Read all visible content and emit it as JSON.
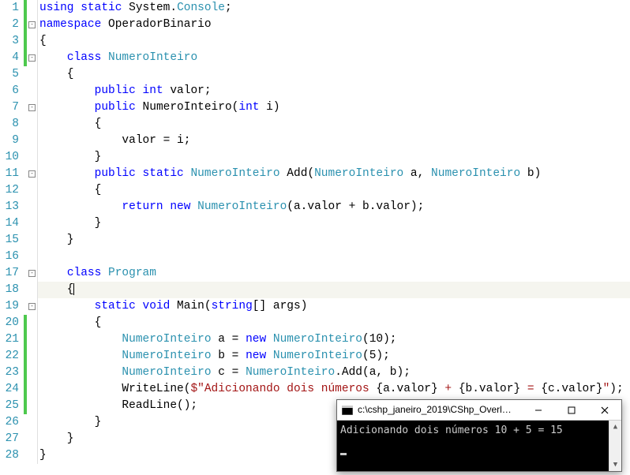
{
  "lines": [
    {
      "n": 1,
      "bar": "green",
      "fold": false,
      "html": "<span class='kw'>using</span> <span class='kw'>static</span> System.<span class='type'>Console</span>;"
    },
    {
      "n": 2,
      "bar": "green",
      "fold": true,
      "html": "<span class='kw'>namespace</span> OperadorBinario"
    },
    {
      "n": 3,
      "bar": "green",
      "fold": false,
      "html": "{"
    },
    {
      "n": 4,
      "bar": "green",
      "fold": true,
      "html": "    <span class='kw'>class</span> <span class='type'>NumeroInteiro</span>"
    },
    {
      "n": 5,
      "bar": "",
      "fold": false,
      "html": "    {"
    },
    {
      "n": 6,
      "bar": "",
      "fold": false,
      "html": "        <span class='kw'>public</span> <span class='kw'>int</span> valor;"
    },
    {
      "n": 7,
      "bar": "",
      "fold": true,
      "html": "        <span class='kw'>public</span> NumeroInteiro(<span class='kw'>int</span> i)"
    },
    {
      "n": 8,
      "bar": "",
      "fold": false,
      "html": "        {"
    },
    {
      "n": 9,
      "bar": "",
      "fold": false,
      "html": "            valor = i;"
    },
    {
      "n": 10,
      "bar": "",
      "fold": false,
      "html": "        }"
    },
    {
      "n": 11,
      "bar": "",
      "fold": true,
      "html": "        <span class='kw'>public</span> <span class='kw'>static</span> <span class='type'>NumeroInteiro</span> Add(<span class='type'>NumeroInteiro</span> a, <span class='type'>NumeroInteiro</span> b)"
    },
    {
      "n": 12,
      "bar": "",
      "fold": false,
      "html": "        {"
    },
    {
      "n": 13,
      "bar": "",
      "fold": false,
      "html": "            <span class='kw'>return</span> <span class='kw'>new</span> <span class='type'>NumeroInteiro</span>(a.valor + b.valor);"
    },
    {
      "n": 14,
      "bar": "",
      "fold": false,
      "html": "        }"
    },
    {
      "n": 15,
      "bar": "",
      "fold": false,
      "html": "    }"
    },
    {
      "n": 16,
      "bar": "",
      "fold": false,
      "html": ""
    },
    {
      "n": 17,
      "bar": "",
      "fold": true,
      "html": "    <span class='kw'>class</span> <span class='type'>Program</span>"
    },
    {
      "n": 18,
      "bar": "",
      "fold": false,
      "hl": true,
      "html": "    {<span class='caret'></span>"
    },
    {
      "n": 19,
      "bar": "",
      "fold": true,
      "html": "        <span class='kw'>static</span> <span class='kw'>void</span> Main(<span class='kw'>string</span>[] args)"
    },
    {
      "n": 20,
      "bar": "green",
      "fold": false,
      "html": "        {"
    },
    {
      "n": 21,
      "bar": "green",
      "fold": false,
      "html": "            <span class='type'>NumeroInteiro</span> a = <span class='kw'>new</span> <span class='type'>NumeroInteiro</span>(10);"
    },
    {
      "n": 22,
      "bar": "green",
      "fold": false,
      "html": "            <span class='type'>NumeroInteiro</span> b = <span class='kw'>new</span> <span class='type'>NumeroInteiro</span>(5);"
    },
    {
      "n": 23,
      "bar": "green",
      "fold": false,
      "html": "            <span class='type'>NumeroInteiro</span> c = <span class='type'>NumeroInteiro</span>.Add(a, b);"
    },
    {
      "n": 24,
      "bar": "green",
      "fold": false,
      "html": "            WriteLine(<span class='str'>$\"Adicionando dois números </span>{a.valor}<span class='str'> + </span>{b.valor}<span class='str'> = </span>{c.valor}<span class='str'>\"</span>);"
    },
    {
      "n": 25,
      "bar": "green",
      "fold": false,
      "html": "            ReadLine();"
    },
    {
      "n": 26,
      "bar": "",
      "fold": false,
      "html": "        }"
    },
    {
      "n": 27,
      "bar": "",
      "fold": false,
      "html": "    }"
    },
    {
      "n": 28,
      "bar": "",
      "fold": false,
      "html": "}"
    }
  ],
  "console": {
    "title": "c:\\cshp_janeiro_2019\\CShp_Overl…",
    "output": "Adicionando dois números 10 + 5 = 15"
  }
}
